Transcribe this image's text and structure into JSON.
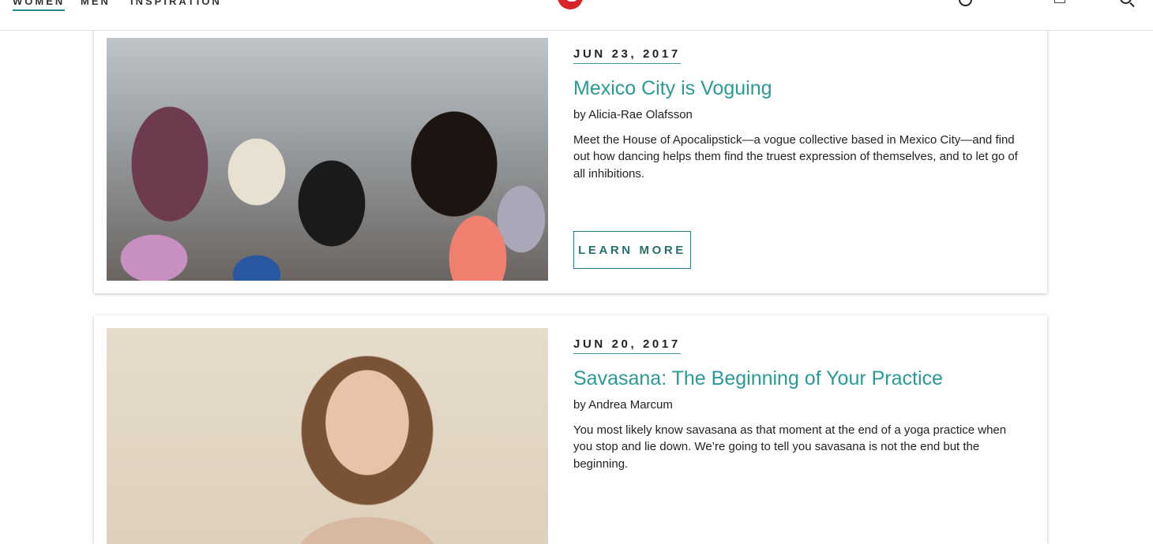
{
  "header": {
    "nav_tabs": [
      {
        "label": "WOMEN",
        "active": true
      },
      {
        "label": "MEN",
        "active": false
      },
      {
        "label": "INSPIRATION",
        "active": false
      }
    ],
    "logo_icon": "brand-logo-icon",
    "icons": [
      "globe-icon",
      "bag-icon",
      "more-icon",
      "search-icon"
    ],
    "accent_color": "#2a9a96",
    "logo_color": "#d9242b"
  },
  "articles": [
    {
      "date": "JUN 23, 2017",
      "title": "Mexico City is Voguing",
      "byline": "by Alicia-Rae Olafsson",
      "summary": "Meet the House of Apocalipstick—a vogue collective based in Mexico City—and find out how dancing helps them find the truest expression of themselves, and to let go of all inhibitions.",
      "cta": "LEARN MORE"
    },
    {
      "date": "JUN 20, 2017",
      "title": "Savasana: The Beginning of Your Practice",
      "byline": "by Andrea Marcum",
      "summary": "You most likely know savasana as that moment at the end of a yoga practice when you stop and lie down. We’re going to tell you savasana is not the end but the beginning."
    }
  ]
}
